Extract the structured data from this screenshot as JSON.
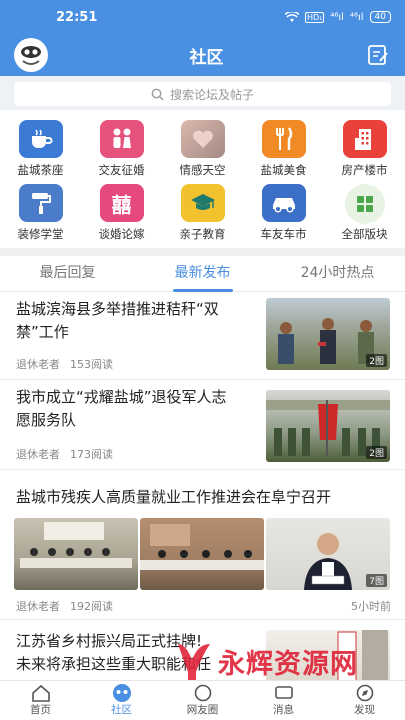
{
  "status_bar": {
    "time": "22:51",
    "net_badge": "HD₁",
    "net1": "⁴⁶ıl",
    "net2": "⁴⁶ıl",
    "battery": "40"
  },
  "header": {
    "title": "社区"
  },
  "search": {
    "placeholder": "搜索论坛及帖子"
  },
  "categories": [
    {
      "label": "盐城茶座",
      "icon": "teacup-icon",
      "color": "#3b7bd6"
    },
    {
      "label": "交友征婚",
      "icon": "couple-icon",
      "color": "#e6527c"
    },
    {
      "label": "情感天空",
      "icon": "love-photo-icon",
      "color": "#c7a29a"
    },
    {
      "label": "盐城美食",
      "icon": "fork-knife-icon",
      "color": "#f08a24"
    },
    {
      "label": "房产楼市",
      "icon": "building-icon",
      "color": "#e8423a"
    },
    {
      "label": "装修学堂",
      "icon": "paint-roller-icon",
      "color": "#4a7cc9"
    },
    {
      "label": "谈婚论嫁",
      "icon": "double-happiness-icon",
      "color": "#e64a7c"
    },
    {
      "label": "亲子教育",
      "icon": "graduation-cap-icon",
      "color": "#f2c22e"
    },
    {
      "label": "车友车市",
      "icon": "car-icon",
      "color": "#3b6fc8"
    },
    {
      "label": "全部版块",
      "icon": "grid-icon",
      "color": "#4aa84a"
    }
  ],
  "tabs": [
    {
      "label": "最后回复",
      "active": false
    },
    {
      "label": "最新发布",
      "active": true
    },
    {
      "label": "24小时热点",
      "active": false
    }
  ],
  "posts": [
    {
      "title_line1": "盐城滨海县多举措推进秸秆“双",
      "title_line2": "禁”工作",
      "author": "退休老者",
      "reads": "153阅读",
      "img_count": "2图"
    },
    {
      "title_line1": "我市成立“戎耀盐城”退役军人志",
      "title_line2": "愿服务队",
      "author": "退休老者",
      "reads": "173阅读",
      "img_count": "2图"
    },
    {
      "title": "盐城市残疾人高质量就业工作推进会在阜宁召开",
      "author": "退休老者",
      "reads": "192阅读",
      "time": "5小时前",
      "img_count": "7图"
    },
    {
      "title_line1": "江苏省乡村振兴局正式挂牌!",
      "title_line2": "未来将承担这些重大职能和任"
    }
  ],
  "bottom_nav": [
    {
      "label": "首页",
      "icon": "home-icon"
    },
    {
      "label": "社区",
      "icon": "community-icon"
    },
    {
      "label": "网友圈",
      "icon": "friends-circle-icon"
    },
    {
      "label": "消息",
      "icon": "message-icon"
    },
    {
      "label": "发现",
      "icon": "discover-icon"
    }
  ],
  "watermark": {
    "text": "永辉资源网",
    "url": "www.yhkjjj.com"
  }
}
